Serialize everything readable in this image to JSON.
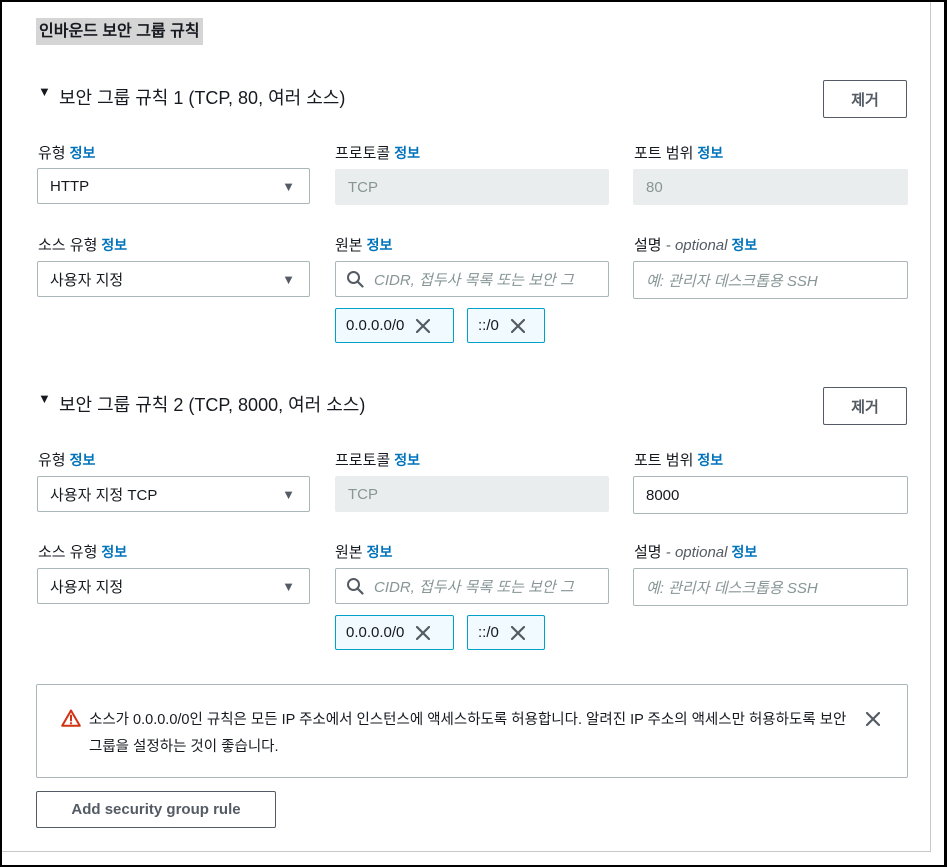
{
  "section_title": "인바운드 보안 그룹 규칙",
  "info_label": "정보",
  "rules": [
    {
      "title": "보안 그룹 규칙 1 (TCP, 80, 여러 소스)",
      "remove_label": "제거",
      "type_label": "유형",
      "type_value": "HTTP",
      "protocol_label": "프로토콜",
      "protocol_value": "TCP",
      "port_label": "포트 범위",
      "port_value": "80",
      "source_type_label": "소스 유형",
      "source_type_value": "사용자 지정",
      "source_label": "원본",
      "source_placeholder": "CIDR, 접두사 목록 또는 보안 그",
      "desc_label": "설명",
      "desc_optional": " - optional",
      "desc_placeholder": "예: 관리자 데스크톱용 SSH",
      "tokens": [
        "0.0.0.0/0",
        "::/0"
      ]
    },
    {
      "title": "보안 그룹 규칙 2 (TCP, 8000, 여러 소스)",
      "remove_label": "제거",
      "type_label": "유형",
      "type_value": "사용자 지정 TCP",
      "protocol_label": "프로토콜",
      "protocol_value": "TCP",
      "port_label": "포트 범위",
      "port_value": "8000",
      "source_type_label": "소스 유형",
      "source_type_value": "사용자 지정",
      "source_label": "원본",
      "source_placeholder": "CIDR, 접두사 목록 또는 보안 그",
      "desc_label": "설명",
      "desc_optional": " - optional",
      "desc_placeholder": "예: 관리자 데스크톱용 SSH",
      "tokens": [
        "0.0.0.0/0",
        "::/0"
      ]
    }
  ],
  "warning": {
    "text": "소스가 0.0.0.0/0인 규칙은 모든 IP 주소에서 인스턴스에 액세스하도록 허용합니다. 알려진 IP 주소의 액세스만 허용하도록 보안 그룹을 설정하는 것이 좋습니다."
  },
  "add_rule_label": "Add security group rule",
  "icons": {
    "caret": "caret-down-icon",
    "dropdown": "chevron-down-icon",
    "search": "search-icon",
    "remove_token": "close-icon",
    "warning": "warning-triangle-icon",
    "dismiss": "close-icon"
  },
  "colors": {
    "info_link": "#0073bb",
    "token_border": "#00a1c9",
    "warning_icon": "#d13212",
    "button_border": "#545b64"
  }
}
